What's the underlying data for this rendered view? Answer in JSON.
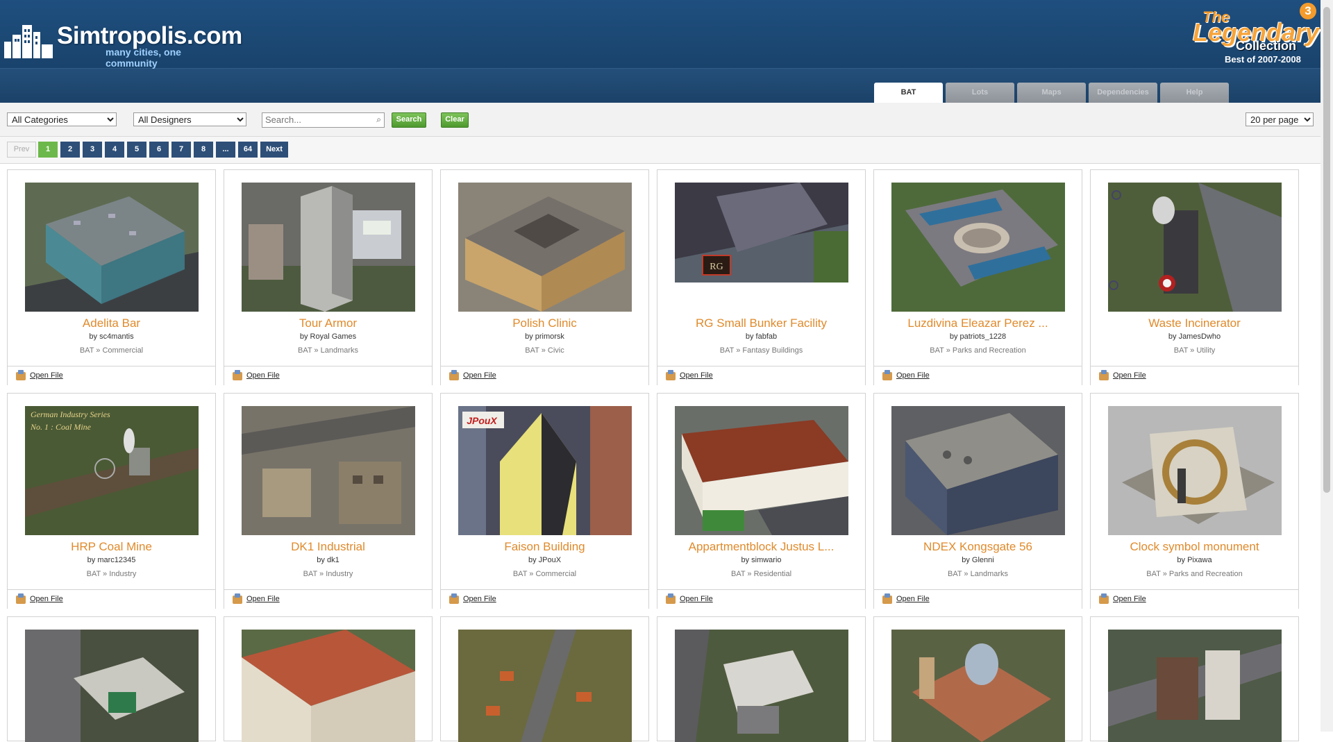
{
  "header": {
    "brand": "Simtropolis.com",
    "tagline": "many cities, one community",
    "collection": {
      "line1": "The",
      "line2": "Legendary",
      "line3": "Collection",
      "line4": "Best of 2007-2008",
      "number": "3"
    },
    "tabs": [
      {
        "label": "BAT"
      },
      {
        "label": "Lots"
      },
      {
        "label": "Maps"
      },
      {
        "label": "Dependencies"
      },
      {
        "label": "Help"
      }
    ]
  },
  "toolbar": {
    "category_selected": "All Categories",
    "designer_selected": "All Designers",
    "search_placeholder": "Search...",
    "search_label": "Search",
    "clear_label": "Clear",
    "per_page_selected": "20 per page"
  },
  "pagination": {
    "prev": "Prev",
    "pages": [
      "1",
      "2",
      "3",
      "4",
      "5",
      "6",
      "7",
      "8",
      "...",
      "64"
    ],
    "next": "Next"
  },
  "open_file_label": "Open File",
  "items": [
    {
      "title": "Adelita Bar",
      "by": "by sc4mantis",
      "category": "BAT » Commercial"
    },
    {
      "title": "Tour Armor",
      "by": "by Royal Games",
      "category": "BAT » Landmarks"
    },
    {
      "title": "Polish Clinic",
      "by": "by primorsk",
      "category": "BAT » Civic"
    },
    {
      "title": "RG Small Bunker Facility",
      "by": "by fabfab",
      "category": "BAT » Fantasy Buildings"
    },
    {
      "title": "Luzdivina Eleazar Perez ...",
      "by": "by patriots_1228",
      "category": "BAT » Parks and Recreation"
    },
    {
      "title": "Waste Incinerator",
      "by": "by JamesDwho",
      "category": "BAT » Utility"
    },
    {
      "title": "HRP Coal Mine",
      "by": "by marc12345",
      "category": "BAT » Industry"
    },
    {
      "title": "DK1 Industrial",
      "by": "by dk1",
      "category": "BAT » Industry"
    },
    {
      "title": "Faison Building",
      "by": "by JPouX",
      "category": "BAT » Commercial"
    },
    {
      "title": "Appartmentblock Justus L...",
      "by": "by simwario",
      "category": "BAT » Residential"
    },
    {
      "title": "NDEX Kongsgate 56",
      "by": "by Glenni",
      "category": "BAT » Landmarks"
    },
    {
      "title": "Clock symbol monument",
      "by": "by Pixawa",
      "category": "BAT » Parks and Recreation"
    }
  ],
  "thumbnail_overlays": {
    "rg_badge": "RG",
    "coal_mine_caption_1": "German Industry Series",
    "coal_mine_caption_2": "No. 1 : Coal Mine",
    "faison_sign": "JPouX"
  }
}
